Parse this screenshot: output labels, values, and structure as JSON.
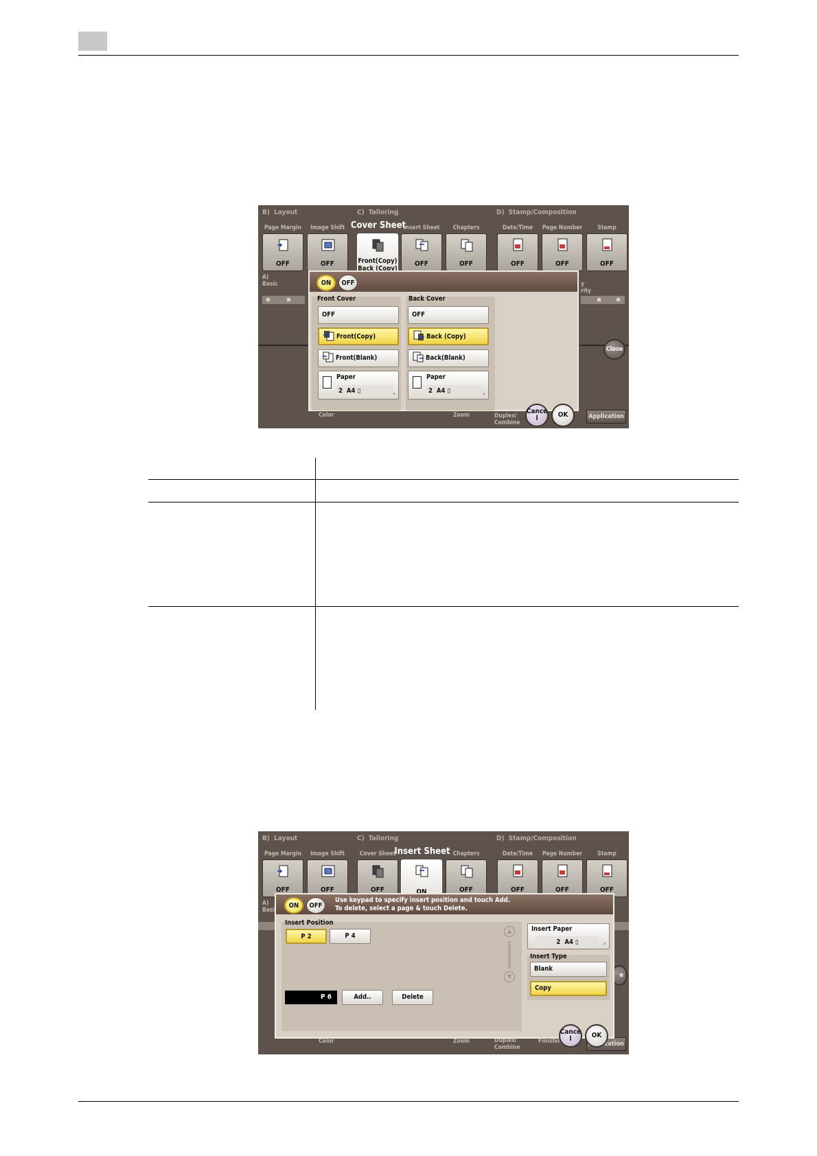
{
  "screen1": {
    "sections": [
      {
        "letter": "B)",
        "name": "Layout"
      },
      {
        "letter": "C)",
        "name": "Tailoring"
      },
      {
        "letter": "D)",
        "name": "Stamp/Composition"
      }
    ],
    "tiles": [
      {
        "label": "Page Margin",
        "value": "OFF",
        "icon": "page-margin-icon"
      },
      {
        "label": "Image Shift",
        "value": "OFF",
        "icon": "image-shift-icon"
      },
      {
        "label": "Cover Sheet",
        "value": "Front(Copy) Back (Copy)",
        "icon": "cover-sheet-icon",
        "active": true
      },
      {
        "label": "Insert Sheet",
        "value": "OFF",
        "icon": "insert-sheet-icon"
      },
      {
        "label": "Chapters",
        "value": "OFF",
        "icon": "chapters-icon"
      },
      {
        "label": "Date/Time",
        "value": "OFF",
        "icon": "date-time-stamp-icon"
      },
      {
        "label": "Page Number",
        "value": "OFF",
        "icon": "page-number-stamp-icon"
      },
      {
        "label": "Stamp",
        "value": "OFF",
        "icon": "stamp-icon"
      }
    ],
    "bg_left": "A)\nBasic",
    "bg_right": "y\nrity",
    "close_label": "Close",
    "bottom_labels": [
      "Color",
      "Zoom",
      "Duplex/\nCombine"
    ],
    "application_label": "Application",
    "dialog": {
      "on_label": "ON",
      "off_label": "OFF",
      "front": {
        "title": "Front Cover",
        "options": [
          "OFF",
          "Front(Copy)",
          "Front(Blank)"
        ],
        "selected": 1,
        "paper_title": "Paper",
        "paper_tray": "2",
        "paper_size": "A4"
      },
      "back": {
        "title": "Back Cover",
        "options": [
          "OFF",
          "Back (Copy)",
          "Back(Blank)"
        ],
        "selected": 1,
        "paper_title": "Paper",
        "paper_tray": "2",
        "paper_size": "A4"
      },
      "cancel_label": "Cance\nl",
      "ok_label": "OK"
    }
  },
  "screen2": {
    "sections": [
      {
        "letter": "B)",
        "name": "Layout"
      },
      {
        "letter": "C)",
        "name": "Tailoring"
      },
      {
        "letter": "D)",
        "name": "Stamp/Composition"
      }
    ],
    "tiles": [
      {
        "label": "Page Margin",
        "value": "OFF",
        "icon": "page-margin-icon"
      },
      {
        "label": "Image Shift",
        "value": "OFF",
        "icon": "image-shift-icon"
      },
      {
        "label": "Cover Sheet",
        "value": "OFF",
        "icon": "cover-sheet-icon"
      },
      {
        "label": "Insert Sheet",
        "value": "ON",
        "icon": "insert-sheet-icon",
        "active": true
      },
      {
        "label": "Chapters",
        "value": "OFF",
        "icon": "chapters-icon"
      },
      {
        "label": "Date/Time",
        "value": "OFF",
        "icon": "date-time-stamp-icon"
      },
      {
        "label": "Page Number",
        "value": "OFF",
        "icon": "page-number-stamp-icon"
      },
      {
        "label": "Stamp",
        "value": "OFF",
        "icon": "stamp-icon"
      }
    ],
    "bg_left": "A)\nBasic",
    "bottom_labels": [
      "Color",
      "Zoom",
      "Duplex/\nCombine",
      "Finishing"
    ],
    "application_label": "Application",
    "close_partial": "e",
    "dialog": {
      "on_label": "ON",
      "off_label": "OFF",
      "message": "Use keypad to specify insert position and touch Add.\nTo delete, select a page & touch Delete.",
      "position_title": "Insert Position",
      "positions": [
        "P 2",
        "P 4"
      ],
      "selected_position": 0,
      "entry_value": "P 6",
      "add_label": "Add..",
      "delete_label": "Delete",
      "insert_paper_title": "Insert Paper",
      "paper_tray": "2",
      "paper_size": "A4",
      "insert_type_title": "Insert Type",
      "types": [
        "Blank",
        "Copy"
      ],
      "selected_type": 1,
      "cancel_label": "Cance\nl",
      "ok_label": "OK"
    }
  },
  "colors": {
    "screen_bg": "#5d524c",
    "dialog_bg": "#d9d1c6",
    "selected_yellow": "#f1d547",
    "dialog_header": "#6e5749"
  }
}
